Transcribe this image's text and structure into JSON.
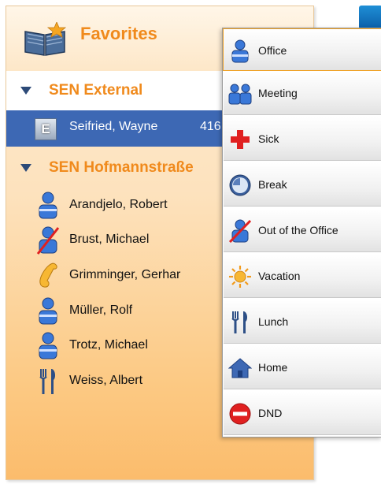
{
  "favorites": {
    "title": "Favorites",
    "groups": [
      {
        "name": "SEN External",
        "contacts": [
          {
            "name": "Seifried, Wayne",
            "number": "416",
            "icon": "external-contact-icon",
            "selected": true
          }
        ]
      },
      {
        "name": "SEN Hofmannstraße",
        "contacts": [
          {
            "name": "Arandjelo, Robert",
            "icon": "office-person-icon"
          },
          {
            "name": "Brust, Michael",
            "icon": "out-of-office-icon"
          },
          {
            "name": "Grimminger, Gerhar",
            "icon": "phone-handset-icon"
          },
          {
            "name": "Müller, Rolf",
            "icon": "office-person-icon"
          },
          {
            "name": "Trotz, Michael",
            "icon": "office-person-icon"
          },
          {
            "name": "Weiss, Albert",
            "icon": "lunch-icon"
          }
        ]
      }
    ]
  },
  "status_menu": {
    "items": [
      {
        "label": "Office",
        "icon": "office-icon"
      },
      {
        "label": "Meeting",
        "icon": "meeting-icon"
      },
      {
        "label": "Sick",
        "icon": "sick-icon"
      },
      {
        "label": "Break",
        "icon": "break-icon"
      },
      {
        "label": "Out of the Office",
        "icon": "out-of-office-icon"
      },
      {
        "label": "Vacation",
        "icon": "vacation-icon"
      },
      {
        "label": "Lunch",
        "icon": "lunch-icon"
      },
      {
        "label": "Home",
        "icon": "home-icon"
      },
      {
        "label": "DND",
        "icon": "dnd-icon"
      }
    ]
  },
  "colors": {
    "accent_orange": "#f08a1c",
    "selection_blue": "#3d68b4",
    "menu_highlight": "#f0a020"
  }
}
